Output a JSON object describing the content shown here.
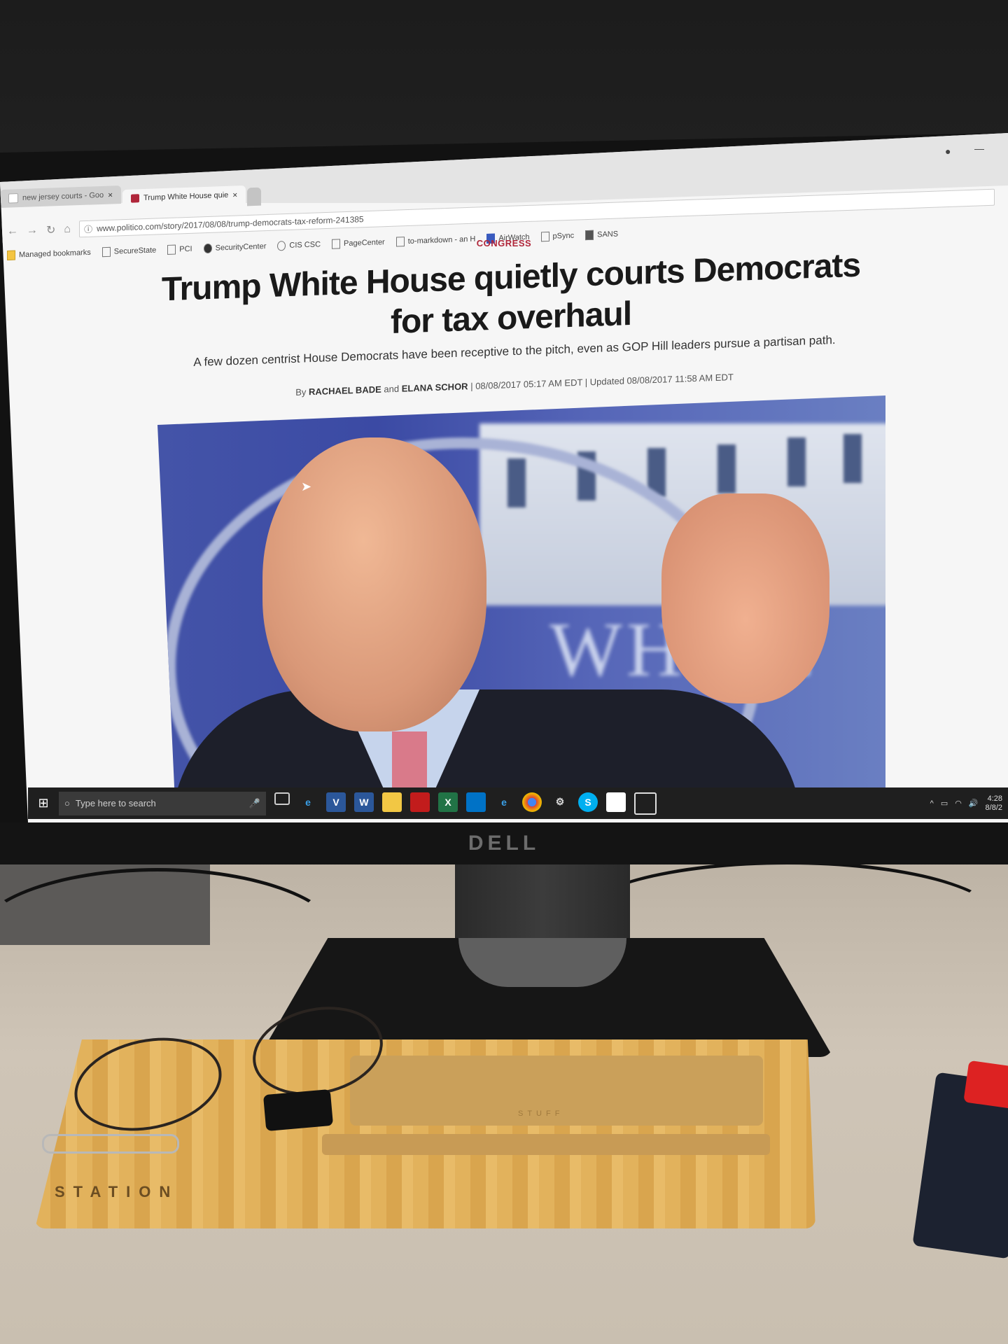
{
  "browser": {
    "tabs": [
      {
        "label": "new jersey courts - Goo",
        "favicon_color": "#ffffff"
      },
      {
        "label": "Trump White House quie",
        "favicon_color": "#b0263a"
      }
    ],
    "close_glyph": "×",
    "url": "www.politico.com/story/2017/08/08/trump-democrats-tax-reform-241385",
    "bookmarks": [
      "Managed bookmarks",
      "SecureState",
      "PCI",
      "SecurityCenter",
      "CIS CSC",
      "PageCenter",
      "to-markdown - an H",
      "AirWatch",
      "pSync",
      "SANS"
    ],
    "window_min": "—"
  },
  "article": {
    "section": "CONGRESS",
    "headline": "Trump White House quietly courts Democrats for tax overhaul",
    "dek": "A few dozen centrist House Democrats have been receptive to the pitch, even as GOP Hill leaders pursue a partisan path.",
    "byline": {
      "prefix": "By",
      "author1": "RACHAEL BADE",
      "and": "and",
      "author2": "ELANA SCHOR",
      "dates": "| 08/08/2017 05:17 AM EDT | Updated 08/08/2017 11:58 AM EDT"
    },
    "photo_text": "WHITE"
  },
  "taskbar": {
    "search_placeholder": "Type here to search",
    "clock_time": "4:28",
    "clock_date": "8/8/2",
    "icons": [
      "task-view-icon",
      "edge-icon",
      "word-icon",
      "word-icon",
      "file-explorer-icon",
      "acrobat-icon",
      "excel-icon",
      "outlook-icon",
      "ie-icon",
      "chrome-icon",
      "settings-icon",
      "skype-icon",
      "app-icon",
      "app-icon"
    ]
  },
  "monitor": {
    "brand": "DELL"
  },
  "desk": {
    "tray_label": "STATION",
    "tray_inner_label": "STUFF"
  }
}
